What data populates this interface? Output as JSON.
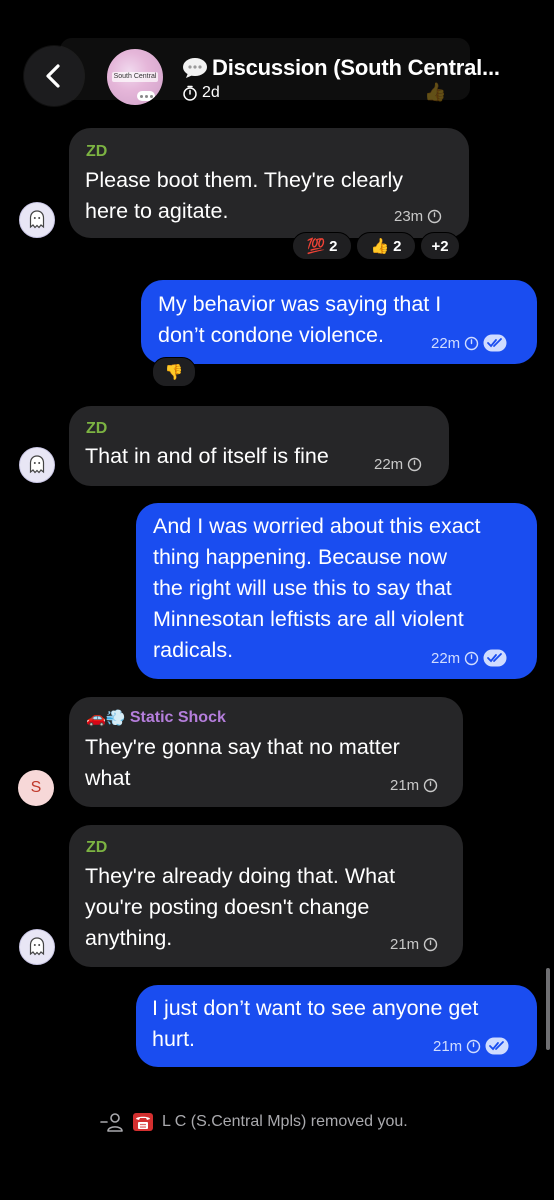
{
  "header": {
    "title": "Discussion (South Central...",
    "subtitle": "2d",
    "avatar_text": "South Central"
  },
  "messages": [
    {
      "sender": "ZD",
      "text_lines": [
        "Please boot them.  They're clearly",
        "here to agitate."
      ],
      "time": "23m",
      "reactions": [
        {
          "emoji": "💯",
          "count": "2"
        },
        {
          "emoji": "👍",
          "count": "2"
        },
        {
          "emoji": "",
          "count": "+2"
        }
      ]
    },
    {
      "text_lines": [
        "My behavior was saying that I",
        "don’t condone violence."
      ],
      "time": "22m",
      "reaction": "👎"
    },
    {
      "sender": "ZD",
      "text_lines": [
        "That in and of itself is fine"
      ],
      "time": "22m"
    },
    {
      "text_lines": [
        "And I was worried about this exact",
        "thing happening. Because now",
        "the right will use this to say that",
        "Minnesotan leftists are all violent",
        "radicals."
      ],
      "time": "22m"
    },
    {
      "sender_emojis": "🚗💨",
      "sender": "Static Shock",
      "avatar_letter": "S",
      "text_lines": [
        "They're gonna say that no matter",
        "what"
      ],
      "time": "21m"
    },
    {
      "sender": "ZD",
      "text_lines": [
        "They're already doing that.  What",
        "you're posting doesn't change",
        "anything."
      ],
      "time": "21m"
    },
    {
      "text_lines": [
        "I just don’t want to see anyone get",
        "hurt."
      ],
      "time": "21m"
    }
  ],
  "system": {
    "text": "L C (S.Central Mpls) removed you."
  },
  "colors": {
    "background": "#000000",
    "incoming_bubble": "#262628",
    "outgoing_bubble": "#1a4df0",
    "sender_green": "#7cb342",
    "sender_purple": "#b57edc"
  }
}
